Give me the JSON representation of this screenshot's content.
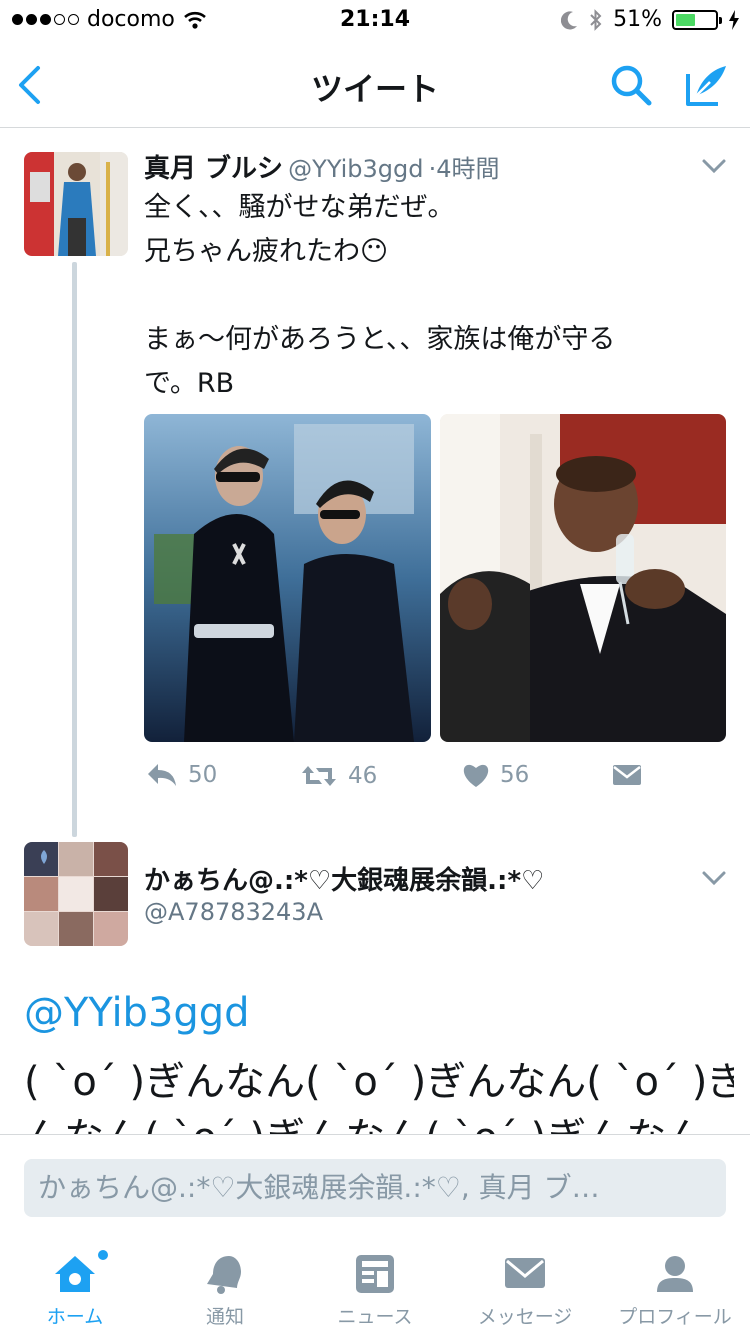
{
  "status_bar": {
    "carrier": "docomo",
    "time": "21:14",
    "battery": "51%",
    "battery_level": 0.51
  },
  "nav": {
    "title": "ツイート"
  },
  "tweet": {
    "name": "真月 ブルシ",
    "handle": "@YYib3ggd",
    "separator": "·",
    "time": "4時間",
    "lines": [
      "全く、、騒がせな弟だぜ。",
      "兄ちゃん疲れたわ😶",
      "",
      "まぁ〜何があろうと、、家族は俺が守る",
      "で。RB"
    ],
    "reply_count": "50",
    "retweet_count": "46",
    "like_count": "56"
  },
  "reply": {
    "name": "かぁちん@.:*♡大銀魂展余韻.:*♡",
    "handle": "@A78783243A",
    "mention": "@YYib3ggd",
    "body_line1": "( `o´ )ぎんなん( `o´ )ぎんなん( `o´ )ぎ",
    "body_line2": "んなん( `o´ )ぎんなん( `o´ )ぎんなん"
  },
  "composer": {
    "placeholder": "かぁちん@.:*♡大銀魂展余韻.:*♡, 真月 ブ…"
  },
  "tabs": [
    {
      "label": "ホーム",
      "icon": "home-icon",
      "active": true
    },
    {
      "label": "通知",
      "icon": "bell-icon",
      "active": false
    },
    {
      "label": "ニュース",
      "icon": "news-icon",
      "active": false
    },
    {
      "label": "メッセージ",
      "icon": "envelope-icon",
      "active": false
    },
    {
      "label": "プロフィール",
      "icon": "person-icon",
      "active": false
    }
  ],
  "colors": {
    "accent": "#1da1f2",
    "link": "#1b95e0",
    "muted": "#8899a6"
  }
}
